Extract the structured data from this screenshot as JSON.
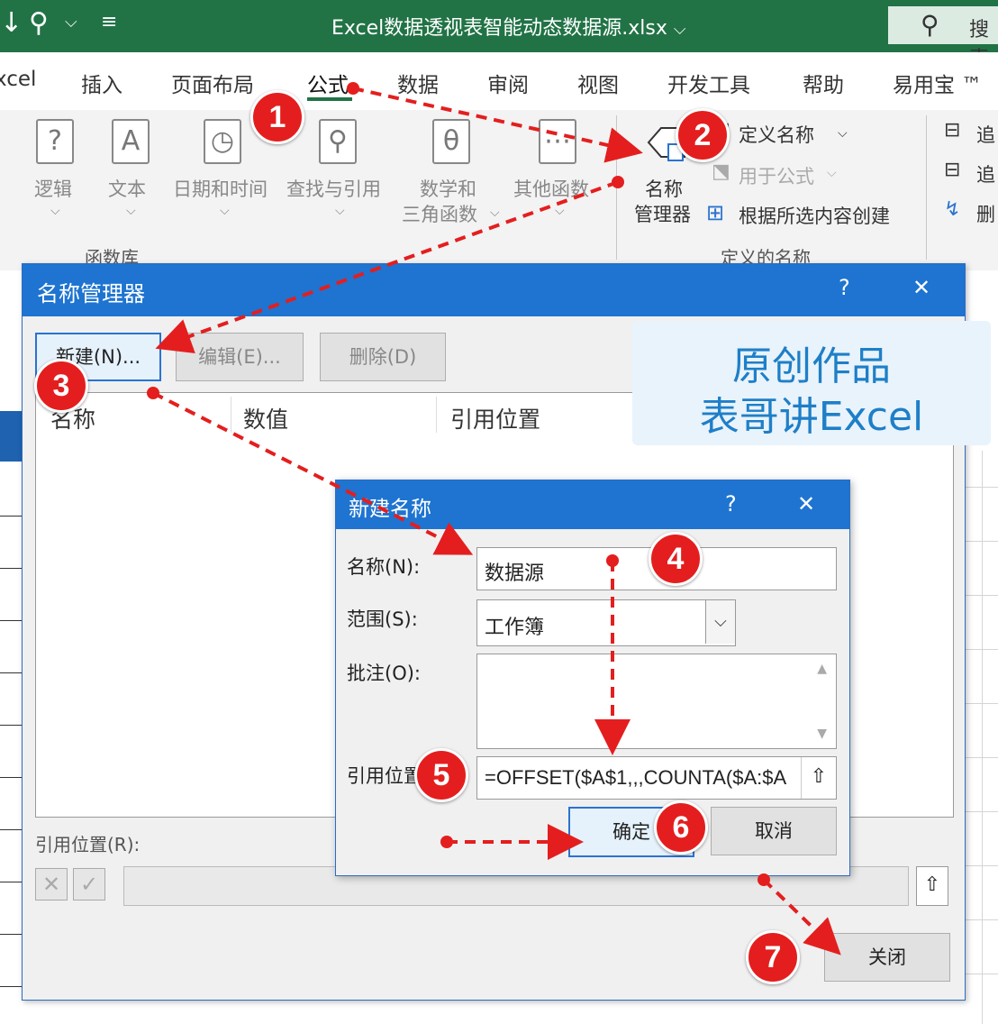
{
  "window": {
    "title": "Excel数据透视表智能动态数据源.xlsx",
    "title_caret": "⌵",
    "search_label": "搜索"
  },
  "tabs": [
    "xcel",
    "插入",
    "页面布局",
    "公式",
    "数据",
    "审阅",
    "视图",
    "开发工具",
    "帮助",
    "易用宝 ™"
  ],
  "ribbon": {
    "function_library": {
      "group_label": "函数库",
      "items": [
        "逻辑",
        "文本",
        "日期和时间",
        "查找与引用",
        "数学和",
        "三角函数",
        "其他函数"
      ]
    },
    "defined_names": {
      "group_label": "定义的名称",
      "name_manager_line1": "名称",
      "name_manager_line2": "管理器",
      "define_name": "定义名称",
      "use_in_formula": "用于公式",
      "create_from_selection": "根据所选内容创建"
    },
    "auditing_partial": [
      "追",
      "追",
      "删"
    ]
  },
  "name_manager": {
    "title": "名称管理器",
    "help": "?",
    "close": "✕",
    "buttons": {
      "new": "新建(N)...",
      "edit": "编辑(E)...",
      "delete": "删除(D)"
    },
    "columns": [
      "名称",
      "数值",
      "引用位置"
    ],
    "refers_to_label": "引用位置(R):",
    "close_button": "关闭"
  },
  "new_name": {
    "title": "新建名称",
    "help": "?",
    "close": "✕",
    "name_label": "名称(N):",
    "name_value": "数据源",
    "scope_label": "范围(S):",
    "scope_value": "工作簿",
    "comment_label": "批注(O):",
    "refers_label": "引用位置",
    "refers_value": "=OFFSET($A$1,,,COUNTA($A:$A",
    "ok": "确定",
    "cancel": "取消"
  },
  "watermark": {
    "line1": "原创作品",
    "line2": "表哥讲Excel"
  },
  "steps": [
    "1",
    "2",
    "3",
    "4",
    "5",
    "6",
    "7"
  ],
  "colors": {
    "excel_green": "#217346",
    "dialog_blue": "#1e74d0",
    "marker_red": "#e41e1e"
  }
}
